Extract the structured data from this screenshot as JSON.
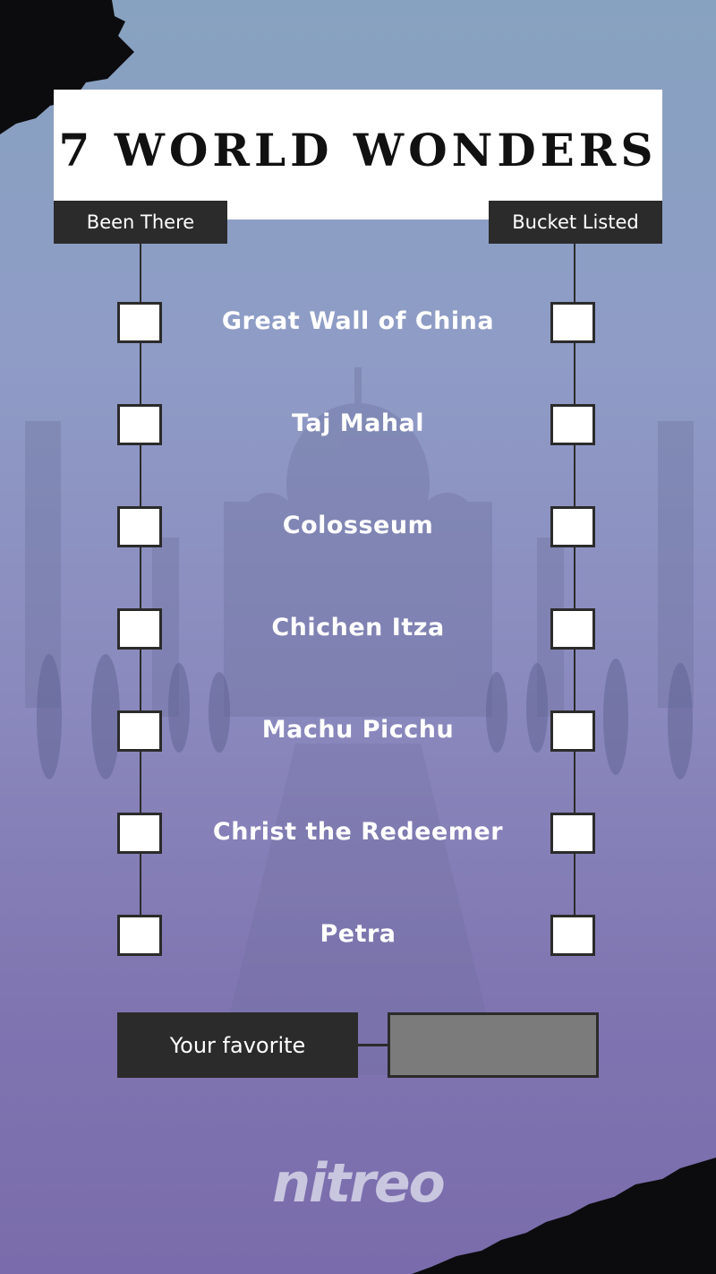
{
  "title": "7 WORLD WONDERS",
  "columns": {
    "left": "Been There",
    "right": "Bucket Listed"
  },
  "wonders": [
    "Great Wall of China",
    "Taj Mahal",
    "Colosseum",
    "Chichen Itza",
    "Machu Picchu",
    "Christ the Redeemer",
    "Petra"
  ],
  "favorite": {
    "label": "Your favorite",
    "value": ""
  },
  "logo": "nitreo",
  "colors": {
    "panel": "#2b2b2b",
    "checkbox": "#ffffff",
    "input": "#7b7b7b"
  }
}
